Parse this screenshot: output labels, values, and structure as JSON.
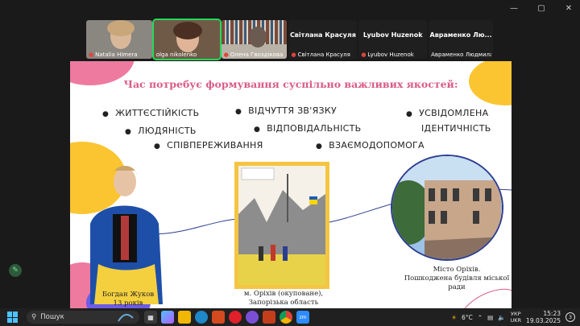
{
  "participants": [
    {
      "name": "Natalia Himera",
      "muted": true,
      "video": true
    },
    {
      "name": "olga nikolenko",
      "muted": false,
      "video": true,
      "speaking": true
    },
    {
      "name": "Олена Гвоздікова",
      "muted": true,
      "video": true
    },
    {
      "name": "Світлана Красуля",
      "display": "Світлана Красуля",
      "muted": true,
      "video": false
    },
    {
      "name": "Lyubov Huzenok",
      "display": "Lyubov Huzenok",
      "muted": true,
      "video": false
    },
    {
      "name": "Авраменко Людмила",
      "display": "Авраменко Лю...",
      "muted": false,
      "video": false
    }
  ],
  "slide": {
    "title": "Час потребує формування суспільно важливих якостей:",
    "bullets": [
      "ЖИТТЄСТІЙКІСТЬ",
      "ВІДЧУТТЯ ЗВ'ЯЗКУ",
      "УСВІДОМЛЕНА",
      "ЛЮДЯНІСТЬ",
      "ВІДПОВІДАЛЬНІСТЬ",
      "ІДЕНТИЧНІСТЬ",
      "СПІВПЕРЕЖИВАННЯ",
      "ВЗАЄМОДОПОМОГА"
    ],
    "captions": {
      "person_name": "Богдан Жуков",
      "person_age": "13 років",
      "drawing_line1": "м. Оріхів (окуповане),",
      "drawing_line2": "Запорізька область",
      "building_line1": "Місто Оріхів.",
      "building_line2": "Пошкоджена будівля міської ради"
    }
  },
  "taskbar": {
    "search_label": "Пошук",
    "weather": "6°C",
    "lang_top": "УКР",
    "lang_bottom": "UKR",
    "time": "15:23",
    "date": "19.03.2025",
    "notifications": "3"
  },
  "colors": {
    "accent_title": "#d95c86",
    "taskbar": "#202020",
    "speaking_border": "#23d959"
  }
}
